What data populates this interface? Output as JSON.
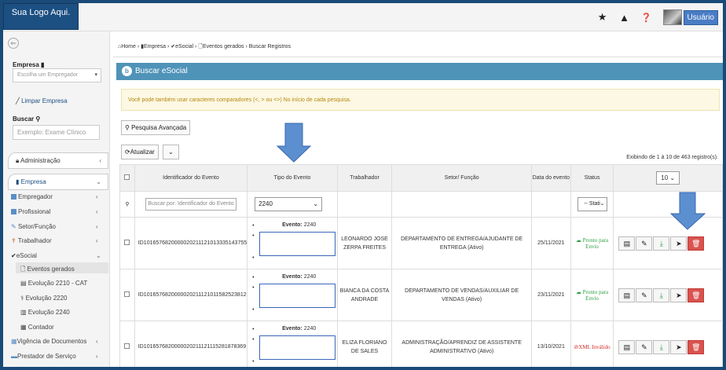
{
  "header": {
    "logo": "Sua Logo Aqui.",
    "user_label": "Usuário",
    "icons": [
      "star-icon",
      "warning-icon",
      "help-icon"
    ]
  },
  "sidebar": {
    "empresa_label": "Empresa",
    "empresa_select_placeholder": "Escolha um Empregador",
    "limpar_label": "Limpar Empresa",
    "buscar_label": "Buscar",
    "buscar_placeholder": "Exemplo: Exame Clínico",
    "sections": [
      {
        "label": "Administração"
      },
      {
        "label": "Empresa"
      }
    ],
    "items": [
      {
        "label": "Empregador"
      },
      {
        "label": "Profissional"
      },
      {
        "label": "Setor/Função"
      },
      {
        "label": "Trabalhador"
      },
      {
        "label": "eSocial"
      },
      {
        "label": "Eventos gerados"
      },
      {
        "label": "Evolução 2210 - CAT"
      },
      {
        "label": "Evolução 2220"
      },
      {
        "label": "Evolução 2240"
      },
      {
        "label": "Contador"
      },
      {
        "label": "Vigência de Documentos"
      },
      {
        "label": "Prestador de Serviço"
      }
    ]
  },
  "breadcrumb": {
    "home": "Home",
    "empresa": "Empresa",
    "esocial": "eSocial",
    "eventos": "Eventos gerados",
    "current": "Buscar Registros"
  },
  "panel": {
    "title": "Buscar eSocial",
    "alert": "Você pode também usar caracteres comparadores (<, > ou <>) No início de cada pesquisa.",
    "advanced_search": "Pesquisa Avançada",
    "refresh": "Atualizar",
    "showing": "Exibindo de 1 à 10 de 463 registro(s).",
    "per_page": "10"
  },
  "table": {
    "headers": [
      "Identificador do Evento",
      "Tipo do Evento",
      "Trabalhador",
      "Setor/ Função",
      "Data do evento",
      "Status"
    ],
    "filter": {
      "id_placeholder": "Buscar por: Identificador do Evento",
      "tipo_value": "2240",
      "status_value": "-- Stati"
    },
    "rows": [
      {
        "id": "ID1016576820000020211121013335143755",
        "evento_label": "Evento:",
        "evento_value": "2240",
        "trabalhador": "LEONARDO JOSE ZERPA FREITES",
        "setor": "DEPARTAMENTO DE ENTREGA/AJUDANTE DE ENTREGA (Ativo)",
        "data": "25/11/2021",
        "status": "Pronto para Envio"
      },
      {
        "id": "ID1016576820000020211121011582523812",
        "evento_label": "Evento:",
        "evento_value": "2240",
        "trabalhador": "BIANCA DA COSTA ANDRADE",
        "setor": "DEPARTAMENTO DE VENDAS/AUXILIAR DE VENDAS (Ativo)",
        "data": "23/11/2021",
        "status": "Pronto para Envio"
      },
      {
        "id": "ID1016576820000020211121115281878369",
        "evento_label": "Evento:",
        "evento_value": "2240",
        "trabalhador": "ELIZA FLORIANO DE SALES",
        "setor": "ADMINISTRAÇÃO/APRENDIZ DE ASSISTENTE ADMINISTRATIVO (Ativo)",
        "data": "13/10/2021",
        "status": "XML Inválido"
      }
    ]
  },
  "colors": {
    "brand": "#1c4f82",
    "panel_header": "#4f93b8",
    "status_ok": "#2e9e44",
    "status_bad": "#d42a2a",
    "annotation_arrow": "#5b8fd0"
  }
}
